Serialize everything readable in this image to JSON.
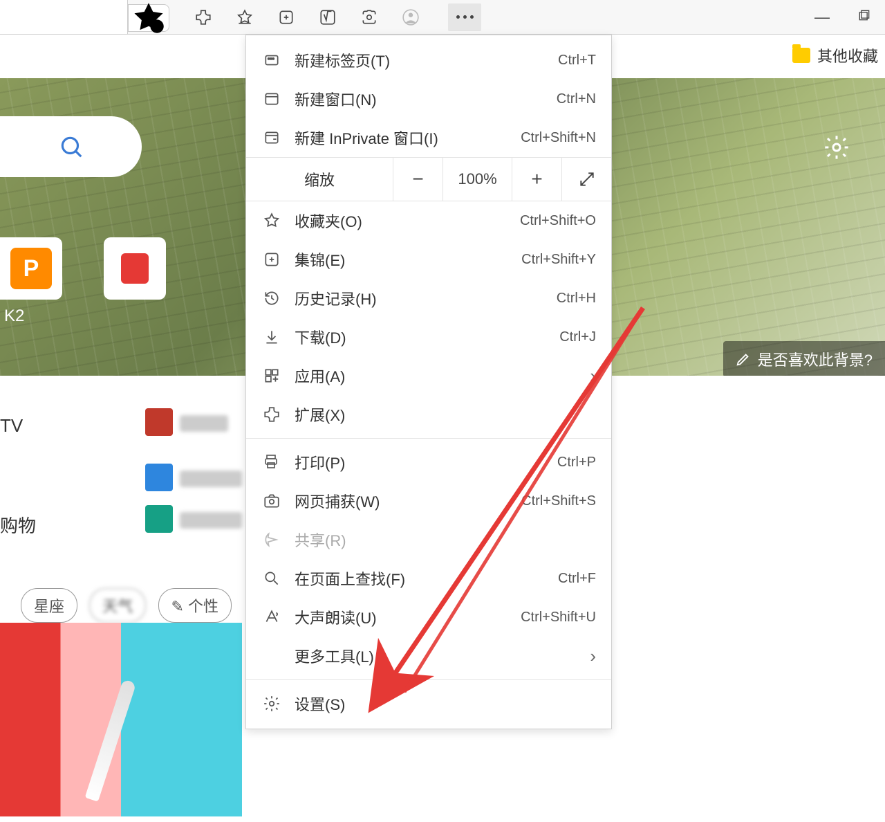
{
  "toolbar_icons": [
    "favorites-star",
    "appearance",
    "extensions",
    "favorites-add",
    "collections",
    "math",
    "screenshot",
    "profile"
  ],
  "bookmarks": {
    "other_favorites": "其他收藏"
  },
  "zoom": {
    "label": "缩放",
    "value": "100%"
  },
  "menu": {
    "new_tab": {
      "label": "新建标签页(T)",
      "shortcut": "Ctrl+T"
    },
    "new_window": {
      "label": "新建窗口(N)",
      "shortcut": "Ctrl+N"
    },
    "new_inprivate": {
      "label": "新建 InPrivate 窗口(I)",
      "shortcut": "Ctrl+Shift+N"
    },
    "favorites": {
      "label": "收藏夹(O)",
      "shortcut": "Ctrl+Shift+O"
    },
    "collections": {
      "label": "集锦(E)",
      "shortcut": "Ctrl+Shift+Y"
    },
    "history": {
      "label": "历史记录(H)",
      "shortcut": "Ctrl+H"
    },
    "downloads": {
      "label": "下载(D)",
      "shortcut": "Ctrl+J"
    },
    "apps": {
      "label": "应用(A)",
      "shortcut": ""
    },
    "extensions": {
      "label": "扩展(X)",
      "shortcut": ""
    },
    "print": {
      "label": "打印(P)",
      "shortcut": "Ctrl+P"
    },
    "web_capture": {
      "label": "网页捕获(W)",
      "shortcut": "Ctrl+Shift+S"
    },
    "share": {
      "label": "共享(R)",
      "shortcut": ""
    },
    "find": {
      "label": "在页面上查找(F)",
      "shortcut": "Ctrl+F"
    },
    "read_aloud": {
      "label": "大声朗读(U)",
      "shortcut": "Ctrl+Shift+U"
    },
    "more_tools": {
      "label": "更多工具(L)",
      "shortcut": ""
    },
    "settings": {
      "label": "设置(S)",
      "shortcut": ""
    }
  },
  "page": {
    "tile_label": "K2",
    "like_bg": "是否喜欢此背景?",
    "tv_label": "TV",
    "shop_label": "购物",
    "pill_star": "星座",
    "pill_pers": "个性"
  }
}
